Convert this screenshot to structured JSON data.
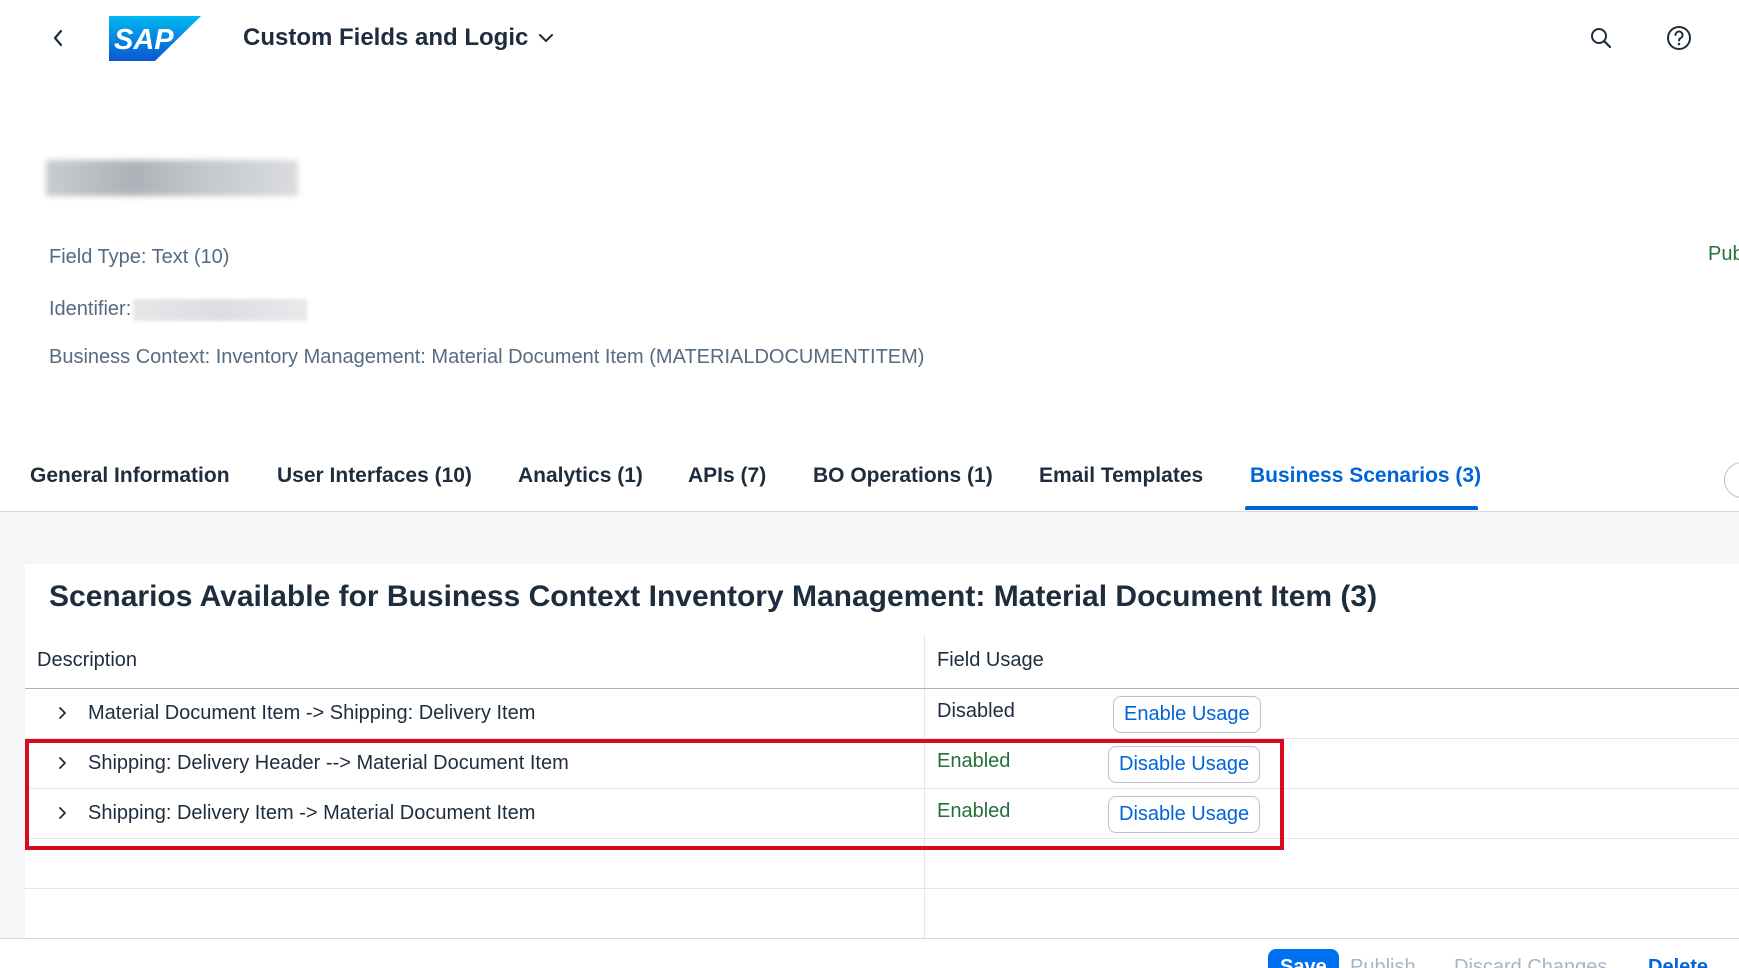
{
  "shell": {
    "logo_text": "SAP",
    "app_title": "Custom Fields and Logic",
    "icons": [
      "back-icon",
      "chevron-down-icon",
      "search-icon",
      "help-icon"
    ]
  },
  "header": {
    "field_type": "Field Type: Text (10)",
    "identifier_label": "Identifier:",
    "business_context": "Business Context: Inventory Management: Material Document Item (MATERIALDOCUMENTITEM)",
    "status_partial": "Pub"
  },
  "tabs": [
    {
      "label": "General Information"
    },
    {
      "label": "User Interfaces (10)"
    },
    {
      "label": "Analytics (1)"
    },
    {
      "label": "APIs (7)"
    },
    {
      "label": "BO Operations (1)"
    },
    {
      "label": "Email Templates"
    },
    {
      "label": "Business Scenarios (3)",
      "active": true
    }
  ],
  "panel": {
    "title": "Scenarios Available for Business Context Inventory Management: Material Document Item (3)",
    "columns": {
      "description": "Description",
      "field_usage": "Field Usage"
    },
    "rows": [
      {
        "description": "Material Document Item -> Shipping: Delivery Item",
        "usage": "Disabled",
        "action": "Enable Usage"
      },
      {
        "description": "Shipping: Delivery Header --> Material Document Item",
        "usage": "Enabled",
        "action": "Disable Usage"
      },
      {
        "description": "Shipping: Delivery Item -> Material Document Item",
        "usage": "Enabled",
        "action": "Disable Usage"
      }
    ]
  },
  "footer": {
    "save": "Save",
    "publish": "Publish",
    "discard": "Discard Changes",
    "delete": "Delete"
  },
  "colors": {
    "accent": "#0064d9",
    "enabled": "#256f3a",
    "highlight": "#d9091e",
    "logo_blue": "#0a6ed1"
  }
}
